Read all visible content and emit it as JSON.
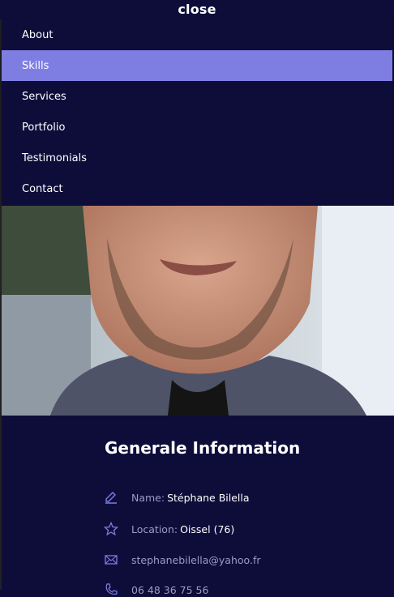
{
  "nav": {
    "close_label": "close",
    "items": [
      {
        "label": "About"
      },
      {
        "label": "Skills"
      },
      {
        "label": "Services"
      },
      {
        "label": "Portfolio"
      },
      {
        "label": "Testimonials"
      },
      {
        "label": "Contact"
      }
    ],
    "active_index": 1
  },
  "profile": {
    "photo_icon": "person-photo",
    "title": "Generale Information",
    "name_label": "Name:",
    "name_value": "Stéphane Bilella",
    "location_label": "Location:",
    "location_value": "Oissel (76)",
    "email": "stephanebilella@yahoo.fr",
    "phone": "06 48 36 75 56"
  },
  "colors": {
    "background": "#0e0d3a",
    "accent": "#7e7ee2",
    "text": "#ffffff",
    "muted_text": "#9c9ac6"
  }
}
